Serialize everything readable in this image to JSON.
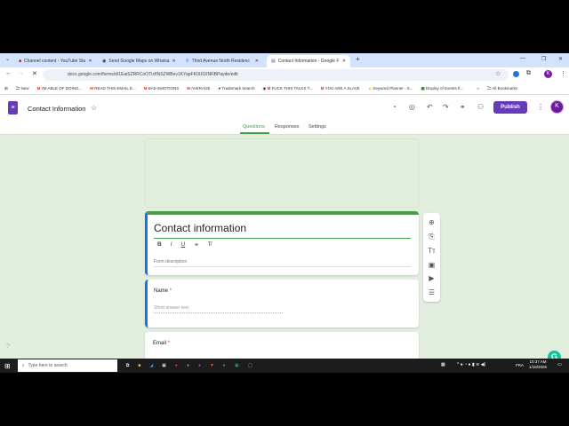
{
  "browser": {
    "tabs": [
      {
        "label": "Channel content - YouTube Stu",
        "icon": "youtube-icon",
        "color": "#e00"
      },
      {
        "label": "Send Google Maps on Whatsa",
        "icon": "globe-icon",
        "color": "#556"
      },
      {
        "label": "Third Avenue North Residenc",
        "icon": "maps-pin-icon",
        "color": "#1a73e8"
      },
      {
        "label": "Contact Information - Google F",
        "icon": "forms-icon",
        "color": "#673ab7"
      }
    ],
    "new_tab": "+",
    "url": "docs.google.com/forms/d/1EaiSZRRCoOTlxfINSZWBev1KYapFK0U0XNRBPayde/edit",
    "bookmarks": [
      "New",
      "I'M ABLE OF DOING...",
      "READ THIS EMAIL E...",
      "BAD EMOTIONS",
      "AVERAGE",
      "Trademark Search",
      "FUCK THIS TALKS T...",
      "YOU ARE A SLAVE",
      "Keyword Planner - S...",
      "Display of Events fr..."
    ],
    "all_bookmarks": "All Bookmarks",
    "profile_letter": "K"
  },
  "app": {
    "doc_title": "Contact Information",
    "publish_label": "Publish",
    "avatar_letter": "K",
    "tabs": [
      "Questions",
      "Responses",
      "Settings"
    ]
  },
  "form": {
    "title": "Contact information",
    "description_placeholder": "Form description",
    "format": [
      "B",
      "I",
      "U",
      "⚭",
      "T̸"
    ],
    "questions": [
      {
        "label": "Name",
        "required": "*",
        "placeholder": "Short answer text"
      },
      {
        "label": "Email",
        "required": "*"
      }
    ]
  },
  "side_tools": [
    "⊕",
    "⎘",
    "Tт",
    "▣",
    "▶",
    "☰"
  ],
  "taskbar": {
    "search_placeholder": "Type here to search",
    "lang": "FRA",
    "time": "10:37 AM",
    "date": "1/18/2026"
  },
  "colors": {
    "accent": "#673ab7",
    "theme": "#43a047",
    "background": "#e2efdf"
  }
}
